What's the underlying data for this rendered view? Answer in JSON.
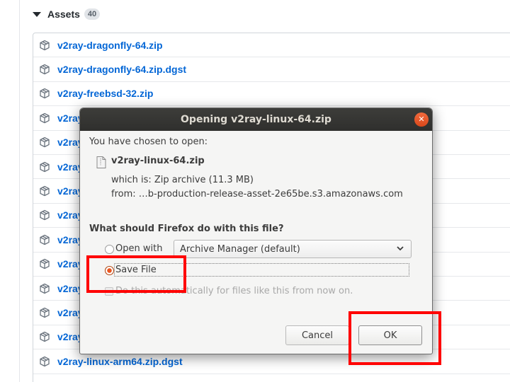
{
  "assets": {
    "title": "Assets",
    "count": "40",
    "items": [
      {
        "label": "v2ray-dragonfly-64.zip"
      },
      {
        "label": "v2ray-dragonfly-64.zip.dgst"
      },
      {
        "label": "v2ray-freebsd-32.zip"
      },
      {
        "label": "v2ray"
      },
      {
        "label": "v2ray"
      },
      {
        "label": "v2ray"
      },
      {
        "label": "v2ray"
      },
      {
        "label": "v2ray"
      },
      {
        "label": "v2ray"
      },
      {
        "label": "v2ray"
      },
      {
        "label": "v2ray"
      },
      {
        "label": "v2ray"
      },
      {
        "label": "v2ray"
      },
      {
        "label": "v2ray-linux-arm64.zip.dgst"
      }
    ]
  },
  "dialog": {
    "title": "Opening v2ray-linux-64.zip",
    "intro": "You have chosen to open:",
    "filename": "v2ray-linux-64.zip",
    "which_is": "which is:  Zip archive (11.3 MB)",
    "from": "from:  …b-production-release-asset-2e65be.s3.amazonaws.com",
    "question": "What should Firefox do with this file?",
    "open_with_label": "Open with",
    "open_with_app": "Archive Manager (default)",
    "save_file_label": "Save File",
    "auto_label": "Do this automatically for files like this from now on.",
    "cancel_label": "Cancel",
    "ok_label": "OK",
    "selected_option": "Save File"
  },
  "colors": {
    "link": "#0366d6",
    "annotation": "#ff0000",
    "titlebar": "#3d3d3a"
  }
}
